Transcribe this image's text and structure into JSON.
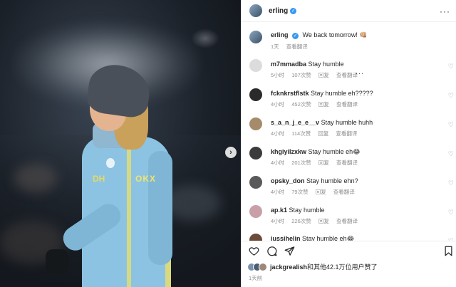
{
  "post": {
    "username": "erling",
    "verified": true,
    "caption_text": "We back tomorrow! 👊🏼",
    "caption_time": "1天",
    "translate": "查看翻译"
  },
  "comments": [
    {
      "user": "m7mmadba",
      "text": "Stay humble",
      "time": "5小时",
      "likes": "107次赞",
      "reply": "回复",
      "translate": "查看翻译",
      "avatar_color": "#dcdcdc",
      "show_more": true
    },
    {
      "user": "fcknkrstflstk",
      "text": "Stay humble eh?????",
      "time": "4小时",
      "likes": "452次赞",
      "reply": "回复",
      "translate": "查看翻译",
      "avatar_color": "#2a2a2a",
      "show_more": false
    },
    {
      "user": "s_a_n_j_e_e__v",
      "text": "Stay humble huhh",
      "time": "4小时",
      "likes": "114次赞",
      "reply": "回复",
      "translate": "查看翻译",
      "avatar_color": "#a58b6a",
      "show_more": false
    },
    {
      "user": "khgiyilzxkw",
      "text": "Stay humble eh😂",
      "time": "4小时",
      "likes": "201次赞",
      "reply": "回复",
      "translate": "查看翻译",
      "avatar_color": "#3b3b3b",
      "show_more": false
    },
    {
      "user": "opsky_don",
      "text": "Stay humble ehn?",
      "time": "4小时",
      "likes": "79次赞",
      "reply": "回复",
      "translate": "查看翻译",
      "avatar_color": "#5a5a5a",
      "show_more": false
    },
    {
      "user": "ap.k1",
      "text": "Stay humble",
      "time": "4小时",
      "likes": "226次赞",
      "reply": "回复",
      "translate": "查看翻译",
      "avatar_color": "#c9a0a8",
      "show_more": false
    },
    {
      "user": "jussihelin",
      "text": "Stay humble eh😂",
      "time": "",
      "likes": "",
      "reply": "",
      "translate": "",
      "avatar_color": "#6b4a3a",
      "show_more": false
    }
  ],
  "footer": {
    "liked_by_user": "jackgrealish",
    "liked_by_rest": "和其他42.1万位用户赞了",
    "date": "1天前"
  },
  "media": {
    "sponsor_left": "DH",
    "sponsor_right": "OKX"
  },
  "colors": {
    "link": "#3897f0",
    "meta": "#8e8e8e",
    "text": "#262626"
  }
}
